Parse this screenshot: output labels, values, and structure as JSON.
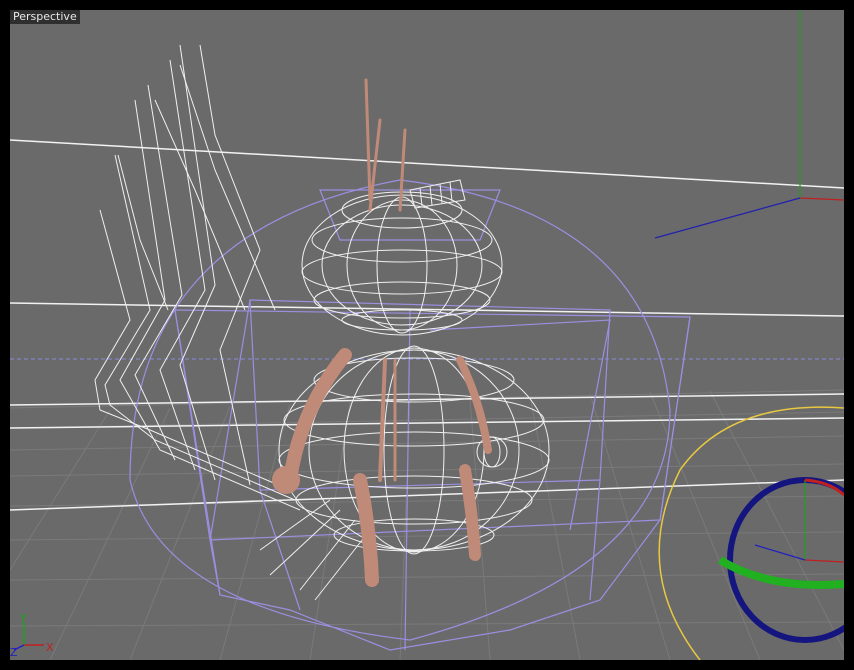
{
  "viewport": {
    "label": "Perspective"
  },
  "axes": {
    "x_label": "X",
    "y_label": "Y",
    "z_label": "Z",
    "x_color": "#c02020",
    "y_color": "#20a020",
    "z_color": "#2020c0"
  },
  "colors": {
    "background": "#6a6a6a",
    "grid": "#777777",
    "wireframe": "#f0f0f0",
    "cage": "#9a8fe0",
    "flesh": "#c08a78",
    "gizmo_ring": "#e8c840"
  }
}
